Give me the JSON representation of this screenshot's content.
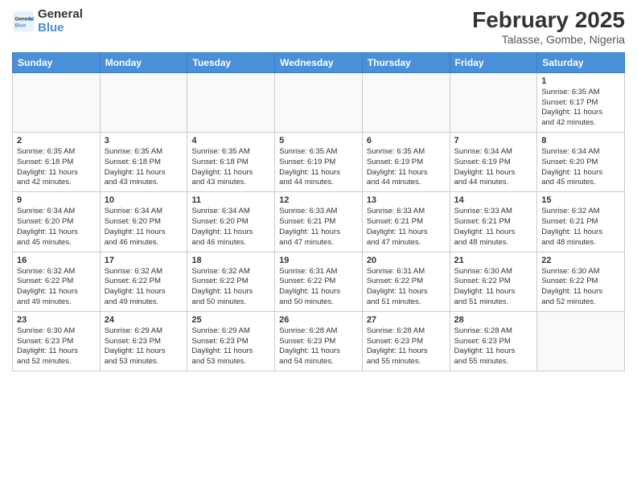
{
  "logo": {
    "line1": "General",
    "line2": "Blue"
  },
  "title": "February 2025",
  "subtitle": "Talasse, Gombe, Nigeria",
  "weekdays": [
    "Sunday",
    "Monday",
    "Tuesday",
    "Wednesday",
    "Thursday",
    "Friday",
    "Saturday"
  ],
  "weeks": [
    [
      {
        "day": "",
        "info": ""
      },
      {
        "day": "",
        "info": ""
      },
      {
        "day": "",
        "info": ""
      },
      {
        "day": "",
        "info": ""
      },
      {
        "day": "",
        "info": ""
      },
      {
        "day": "",
        "info": ""
      },
      {
        "day": "1",
        "info": "Sunrise: 6:35 AM\nSunset: 6:17 PM\nDaylight: 11 hours\nand 42 minutes."
      }
    ],
    [
      {
        "day": "2",
        "info": "Sunrise: 6:35 AM\nSunset: 6:18 PM\nDaylight: 11 hours\nand 42 minutes."
      },
      {
        "day": "3",
        "info": "Sunrise: 6:35 AM\nSunset: 6:18 PM\nDaylight: 11 hours\nand 43 minutes."
      },
      {
        "day": "4",
        "info": "Sunrise: 6:35 AM\nSunset: 6:18 PM\nDaylight: 11 hours\nand 43 minutes."
      },
      {
        "day": "5",
        "info": "Sunrise: 6:35 AM\nSunset: 6:19 PM\nDaylight: 11 hours\nand 44 minutes."
      },
      {
        "day": "6",
        "info": "Sunrise: 6:35 AM\nSunset: 6:19 PM\nDaylight: 11 hours\nand 44 minutes."
      },
      {
        "day": "7",
        "info": "Sunrise: 6:34 AM\nSunset: 6:19 PM\nDaylight: 11 hours\nand 44 minutes."
      },
      {
        "day": "8",
        "info": "Sunrise: 6:34 AM\nSunset: 6:20 PM\nDaylight: 11 hours\nand 45 minutes."
      }
    ],
    [
      {
        "day": "9",
        "info": "Sunrise: 6:34 AM\nSunset: 6:20 PM\nDaylight: 11 hours\nand 45 minutes."
      },
      {
        "day": "10",
        "info": "Sunrise: 6:34 AM\nSunset: 6:20 PM\nDaylight: 11 hours\nand 46 minutes."
      },
      {
        "day": "11",
        "info": "Sunrise: 6:34 AM\nSunset: 6:20 PM\nDaylight: 11 hours\nand 46 minutes."
      },
      {
        "day": "12",
        "info": "Sunrise: 6:33 AM\nSunset: 6:21 PM\nDaylight: 11 hours\nand 47 minutes."
      },
      {
        "day": "13",
        "info": "Sunrise: 6:33 AM\nSunset: 6:21 PM\nDaylight: 11 hours\nand 47 minutes."
      },
      {
        "day": "14",
        "info": "Sunrise: 6:33 AM\nSunset: 6:21 PM\nDaylight: 11 hours\nand 48 minutes."
      },
      {
        "day": "15",
        "info": "Sunrise: 6:32 AM\nSunset: 6:21 PM\nDaylight: 11 hours\nand 48 minutes."
      }
    ],
    [
      {
        "day": "16",
        "info": "Sunrise: 6:32 AM\nSunset: 6:22 PM\nDaylight: 11 hours\nand 49 minutes."
      },
      {
        "day": "17",
        "info": "Sunrise: 6:32 AM\nSunset: 6:22 PM\nDaylight: 11 hours\nand 49 minutes."
      },
      {
        "day": "18",
        "info": "Sunrise: 6:32 AM\nSunset: 6:22 PM\nDaylight: 11 hours\nand 50 minutes."
      },
      {
        "day": "19",
        "info": "Sunrise: 6:31 AM\nSunset: 6:22 PM\nDaylight: 11 hours\nand 50 minutes."
      },
      {
        "day": "20",
        "info": "Sunrise: 6:31 AM\nSunset: 6:22 PM\nDaylight: 11 hours\nand 51 minutes."
      },
      {
        "day": "21",
        "info": "Sunrise: 6:30 AM\nSunset: 6:22 PM\nDaylight: 11 hours\nand 51 minutes."
      },
      {
        "day": "22",
        "info": "Sunrise: 6:30 AM\nSunset: 6:22 PM\nDaylight: 11 hours\nand 52 minutes."
      }
    ],
    [
      {
        "day": "23",
        "info": "Sunrise: 6:30 AM\nSunset: 6:23 PM\nDaylight: 11 hours\nand 52 minutes."
      },
      {
        "day": "24",
        "info": "Sunrise: 6:29 AM\nSunset: 6:23 PM\nDaylight: 11 hours\nand 53 minutes."
      },
      {
        "day": "25",
        "info": "Sunrise: 6:29 AM\nSunset: 6:23 PM\nDaylight: 11 hours\nand 53 minutes."
      },
      {
        "day": "26",
        "info": "Sunrise: 6:28 AM\nSunset: 6:23 PM\nDaylight: 11 hours\nand 54 minutes."
      },
      {
        "day": "27",
        "info": "Sunrise: 6:28 AM\nSunset: 6:23 PM\nDaylight: 11 hours\nand 55 minutes."
      },
      {
        "day": "28",
        "info": "Sunrise: 6:28 AM\nSunset: 6:23 PM\nDaylight: 11 hours\nand 55 minutes."
      },
      {
        "day": "",
        "info": ""
      }
    ]
  ]
}
